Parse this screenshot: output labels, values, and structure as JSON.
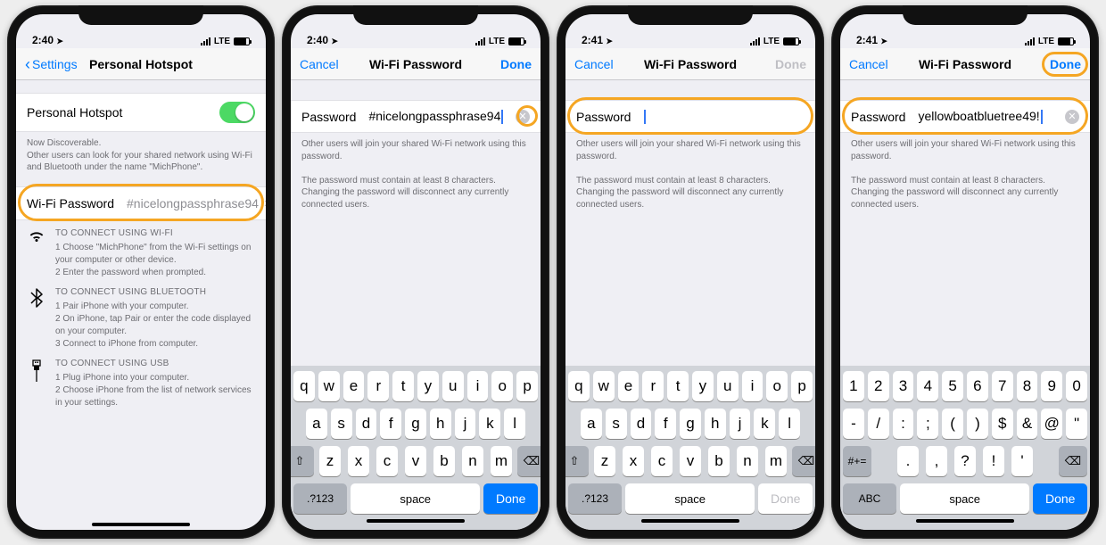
{
  "s1": {
    "time": "2:40",
    "net": "LTE",
    "back": "Settings",
    "title": "Personal Hotspot",
    "toggleLabel": "Personal Hotspot",
    "disc1": "Now Discoverable.",
    "disc2": "Other users can look for your shared network using Wi-Fi and Bluetooth under the name \"MichPhone\".",
    "pwdLabel": "Wi-Fi Password",
    "pwdValue": "#nicelongpassphrase94",
    "wifi": {
      "hd": "TO CONNECT USING WI-FI",
      "l1": "1 Choose \"MichPhone\" from the Wi-Fi settings on your computer or other device.",
      "l2": "2 Enter the password when prompted."
    },
    "bt": {
      "hd": "TO CONNECT USING BLUETOOTH",
      "l1": "1 Pair iPhone with your computer.",
      "l2": "2 On iPhone, tap Pair or enter the code displayed on your computer.",
      "l3": "3 Connect to iPhone from computer."
    },
    "usb": {
      "hd": "TO CONNECT USING USB",
      "l1": "1 Plug iPhone into your computer.",
      "l2": "2 Choose iPhone from the list of network services in your settings."
    }
  },
  "s2": {
    "time": "2:40",
    "net": "LTE",
    "cancel": "Cancel",
    "title": "Wi-Fi Password",
    "done": "Done",
    "label": "Password",
    "value": "#nicelongpassphrase94",
    "help1": "Other users will join your shared Wi-Fi network using this password.",
    "help2": "The password must contain at least 8 characters. Changing the password will disconnect any currently connected users."
  },
  "s3": {
    "time": "2:41",
    "net": "LTE",
    "cancel": "Cancel",
    "title": "Wi-Fi Password",
    "done": "Done",
    "label": "Password",
    "value": "",
    "help1": "Other users will join your shared Wi-Fi network using this password.",
    "help2": "The password must contain at least 8 characters. Changing the password will disconnect any currently connected users."
  },
  "s4": {
    "time": "2:41",
    "net": "LTE",
    "cancel": "Cancel",
    "title": "Wi-Fi Password",
    "done": "Done",
    "label": "Password",
    "value": "yellowboatbluetree49!",
    "help1": "Other users will join your shared Wi-Fi network using this password.",
    "help2": "The password must contain at least 8 characters. Changing the password will disconnect any currently connected users."
  },
  "kbd": {
    "r1": [
      "q",
      "w",
      "e",
      "r",
      "t",
      "y",
      "u",
      "i",
      "o",
      "p"
    ],
    "r2": [
      "a",
      "s",
      "d",
      "f",
      "g",
      "h",
      "j",
      "k",
      "l"
    ],
    "r3": [
      "z",
      "x",
      "c",
      "v",
      "b",
      "n",
      "m"
    ],
    "numSwitch": ".?123",
    "space": "space",
    "done": "Done",
    "nr1": [
      "1",
      "2",
      "3",
      "4",
      "5",
      "6",
      "7",
      "8",
      "9",
      "0"
    ],
    "nr2": [
      "-",
      "/",
      ":",
      ";",
      "(",
      ")",
      "$",
      "&",
      "@",
      "\""
    ],
    "nr3": [
      ".",
      ",",
      "?",
      "!",
      "'"
    ],
    "symSwitch": "#+=",
    "abc": "ABC"
  }
}
